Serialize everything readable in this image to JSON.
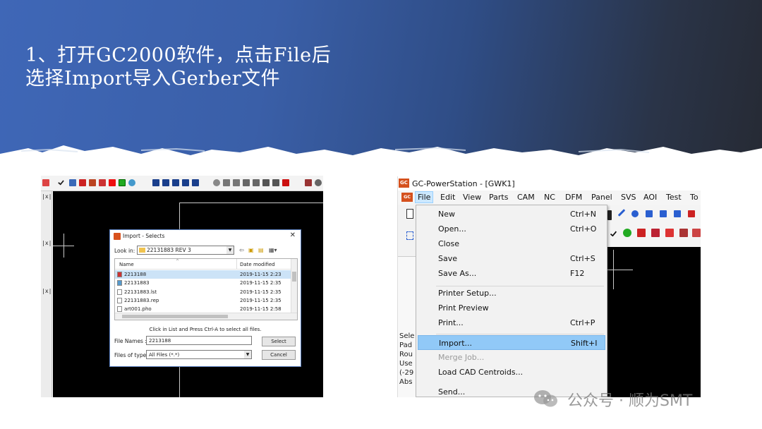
{
  "slide": {
    "title_line1": "1、打开GC2000软件，点击File后",
    "title_line2": "选择Import导入Gerber文件",
    "banner_colors": [
      "#3f67b7",
      "#262a34"
    ]
  },
  "left_screenshot": {
    "side_markers": [
      "|x|",
      "|x|",
      "|x|"
    ],
    "dialog": {
      "title": "Import - Selects",
      "close_glyph": "✕",
      "look_in_label": "Look in:",
      "look_in_value": "22131883 REV 3",
      "columns": {
        "name": "Name",
        "date": "Date modified"
      },
      "files": [
        {
          "name": "2213188",
          "date": "2019-11-15 2:23",
          "selected": true
        },
        {
          "name": "22131883",
          "date": "2019-11-15 2:35",
          "selected": false
        },
        {
          "name": "22131883.lst",
          "date": "2019-11-15 2:35",
          "selected": false
        },
        {
          "name": "22131883.rep",
          "date": "2019-11-15 2:35",
          "selected": false
        },
        {
          "name": "art001.pho",
          "date": "2019-11-15 2:58",
          "selected": false
        }
      ],
      "hint": "Click in List and Press Ctrl-A to select all files.",
      "file_names_label": "File Names :",
      "file_names_value": "2213188",
      "files_of_type_label": "Files of type:",
      "files_of_type_value": "All Files (*.*)",
      "select_button": "Select",
      "cancel_button": "Cancel"
    }
  },
  "right_screenshot": {
    "logo_text": "GC",
    "window_title": "GC-PowerStation - [GWK1]",
    "menubar": [
      "File",
      "Edit",
      "View",
      "Parts",
      "CAM",
      "NC",
      "DFM",
      "Panel",
      "SVS",
      "AOI",
      "Test",
      "To"
    ],
    "left_pane_lines": [
      "Sele",
      "Pad",
      "Rou",
      "Use",
      "(-29",
      "Abs"
    ],
    "file_menu": [
      {
        "label": "New",
        "shortcut": "Ctrl+N",
        "state": "normal"
      },
      {
        "label": "Open...",
        "shortcut": "Ctrl+O",
        "state": "normal"
      },
      {
        "label": "Close",
        "shortcut": "",
        "state": "normal"
      },
      {
        "label": "Save",
        "shortcut": "Ctrl+S",
        "state": "normal"
      },
      {
        "label": "Save As...",
        "shortcut": "F12",
        "state": "normal"
      },
      {
        "label": "Printer Setup...",
        "shortcut": "",
        "state": "normal"
      },
      {
        "label": "Print Preview",
        "shortcut": "",
        "state": "normal"
      },
      {
        "label": "Print...",
        "shortcut": "Ctrl+P",
        "state": "normal"
      },
      {
        "label": "Import...",
        "shortcut": "Shift+I",
        "state": "highlighted"
      },
      {
        "label": "Merge Job...",
        "shortcut": "",
        "state": "disabled"
      },
      {
        "label": "Load CAD Centroids...",
        "shortcut": "",
        "state": "normal"
      },
      {
        "label": "Send...",
        "shortcut": "",
        "state": "normal"
      }
    ],
    "highlight_color": "#91c9f7"
  },
  "watermark": {
    "text": "公众号 · 顺为SMT",
    "icon": "wechat-icon"
  }
}
